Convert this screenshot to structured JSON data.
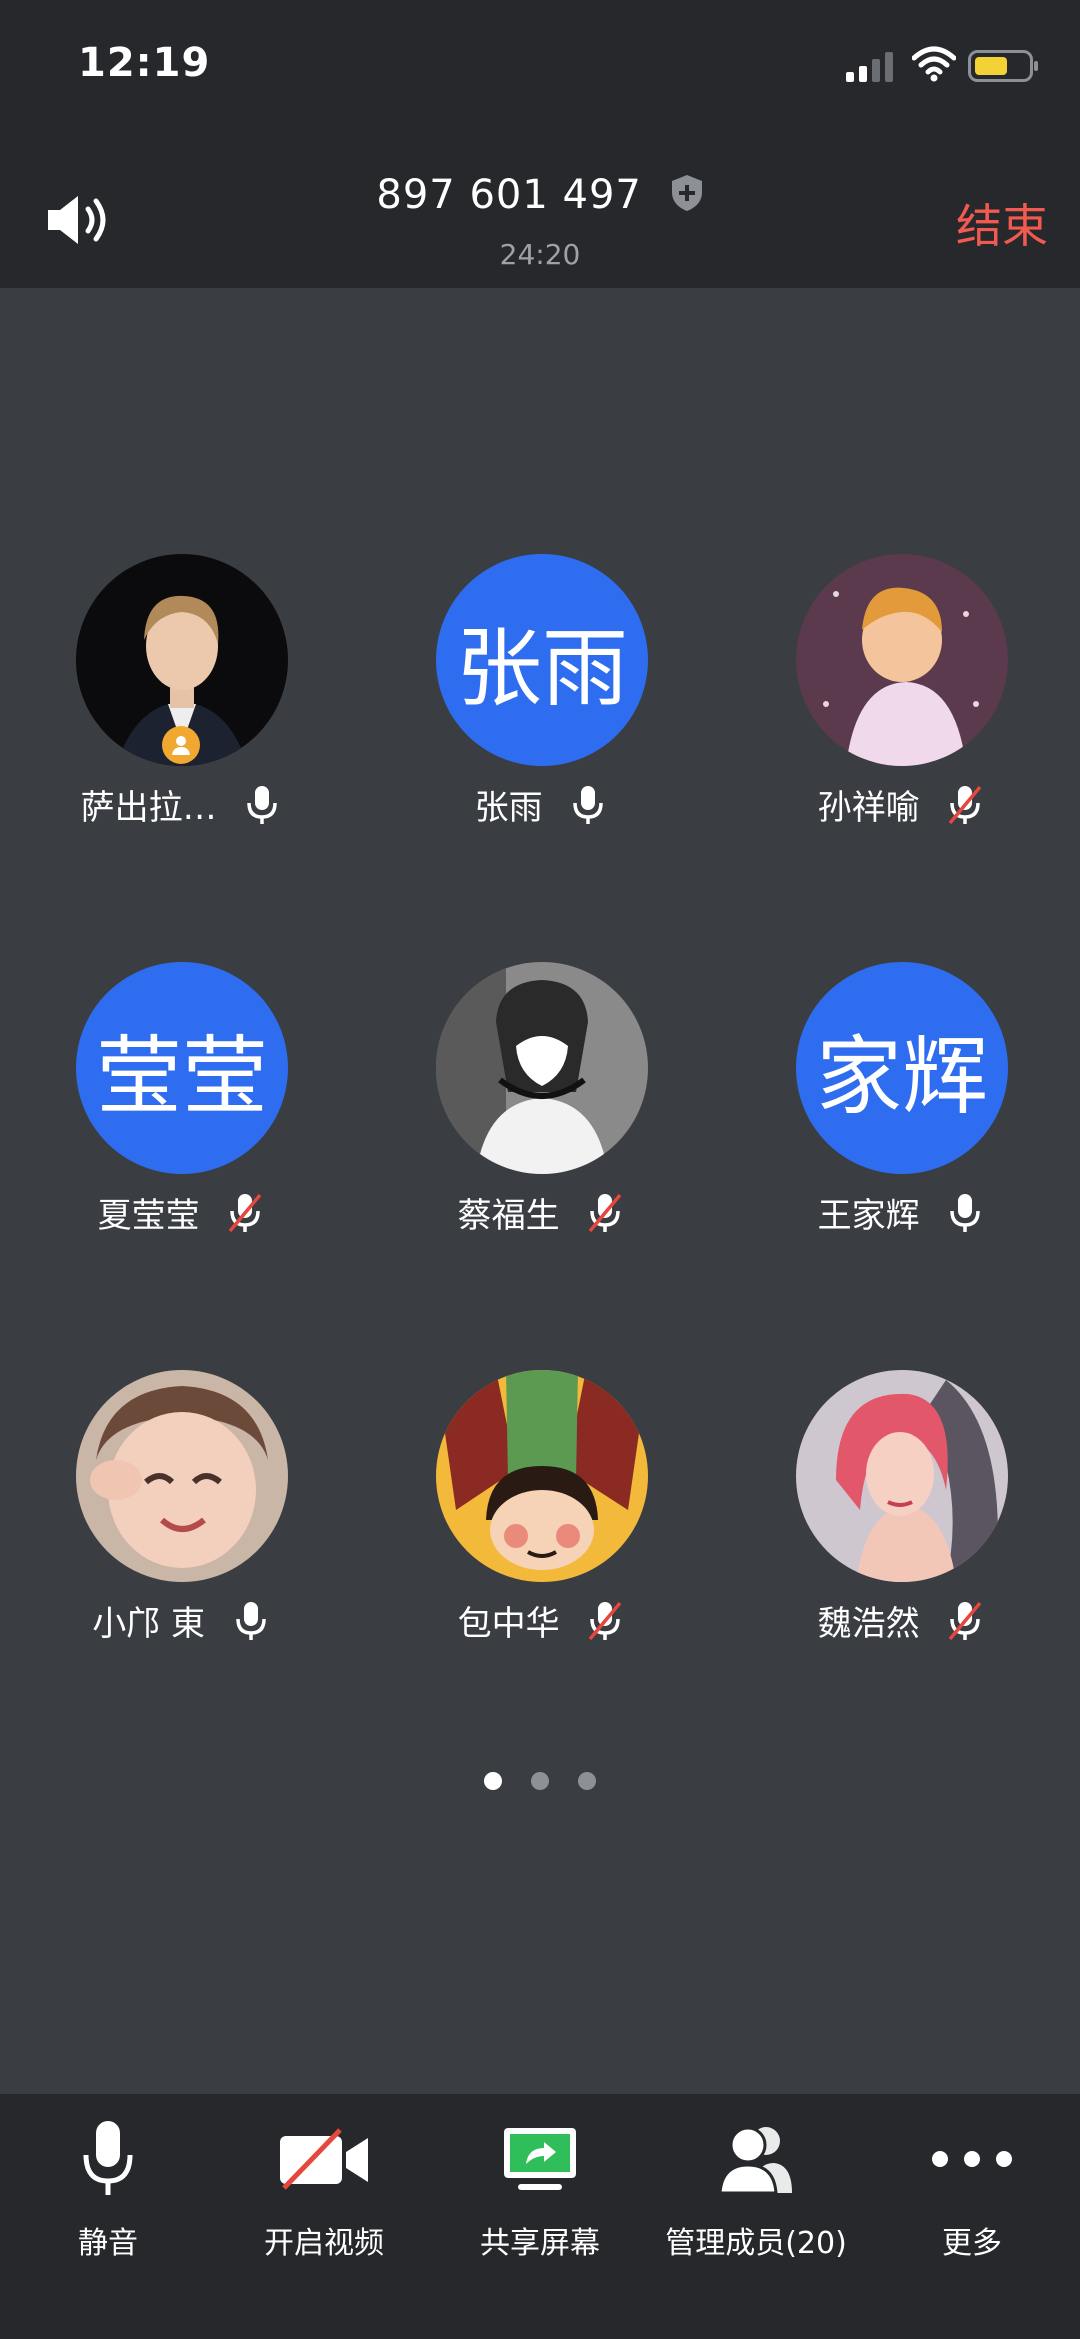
{
  "status_bar": {
    "time": "12:19"
  },
  "header": {
    "meeting_id": "897 601 497",
    "duration": "24:20",
    "end_label": "结束"
  },
  "participants": [
    {
      "name": "萨出拉…",
      "avatar_text": "",
      "mic": "on",
      "host": true
    },
    {
      "name": "张雨",
      "avatar_text": "张雨",
      "mic": "on",
      "host": false
    },
    {
      "name": "孙祥喻",
      "avatar_text": "",
      "mic": "muted",
      "host": false
    },
    {
      "name": "夏莹莹",
      "avatar_text": "莹莹",
      "mic": "muted",
      "host": false
    },
    {
      "name": "蔡福生",
      "avatar_text": "",
      "mic": "muted",
      "host": false
    },
    {
      "name": "王家辉",
      "avatar_text": "家辉",
      "mic": "on",
      "host": false
    },
    {
      "name": "小邝 東",
      "avatar_text": "",
      "mic": "on",
      "host": false
    },
    {
      "name": "包中华",
      "avatar_text": "",
      "mic": "muted",
      "host": false
    },
    {
      "name": "魏浩然",
      "avatar_text": "",
      "mic": "muted",
      "host": false
    }
  ],
  "pagination": {
    "total": 3,
    "current": 1
  },
  "toolbar": {
    "mute_label": "静音",
    "video_label": "开启视频",
    "share_label": "共享屏幕",
    "members_label": "管理成员(20)",
    "more_label": "更多"
  },
  "colors": {
    "accent_blue": "#2f6df0",
    "end_red": "#f05a50",
    "share_green": "#2fbe5a",
    "muted_red": "#e5473d"
  }
}
